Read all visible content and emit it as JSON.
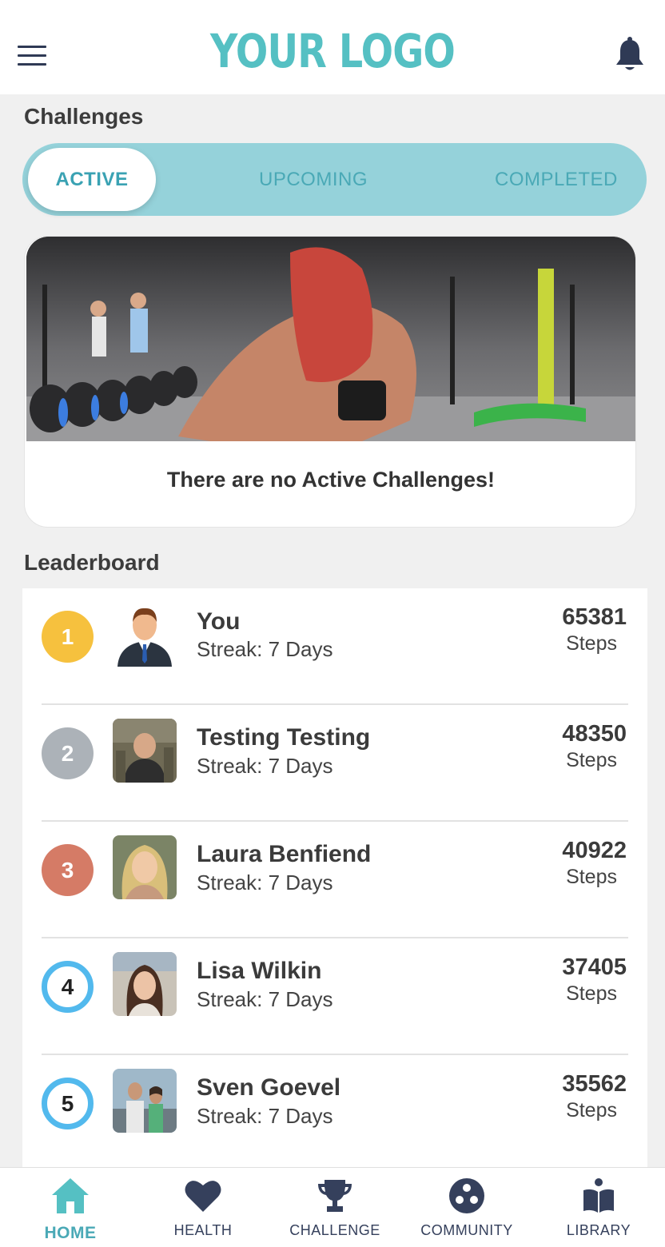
{
  "header": {
    "logo_text": "YOUR LOGO",
    "menu_icon": "hamburger-menu-icon",
    "notification_icon": "bell-icon"
  },
  "challenges": {
    "title": "Challenges",
    "tabs": [
      {
        "label": "ACTIVE",
        "selected": true
      },
      {
        "label": "UPCOMING",
        "selected": false
      },
      {
        "label": "COMPLETED",
        "selected": false
      }
    ],
    "empty_message": "There are no Active Challenges!"
  },
  "leaderboard": {
    "title": "Leaderboard",
    "entries": [
      {
        "rank": "1",
        "name": "You",
        "streak": "Streak: 7 Days",
        "steps": "65381",
        "unit": "Steps",
        "badge": "gold"
      },
      {
        "rank": "2",
        "name": "Testing Testing",
        "streak": "Streak: 7 Days",
        "steps": "48350",
        "unit": "Steps",
        "badge": "silver"
      },
      {
        "rank": "3",
        "name": "Laura Benfiend",
        "streak": "Streak: 7 Days",
        "steps": "40922",
        "unit": "Steps",
        "badge": "bronze"
      },
      {
        "rank": "4",
        "name": "Lisa Wilkin",
        "streak": "Streak: 7 Days",
        "steps": "37405",
        "unit": "Steps",
        "badge": "ring"
      },
      {
        "rank": "5",
        "name": "Sven Goevel",
        "streak": "Streak: 7 Days",
        "steps": "35562",
        "unit": "Steps",
        "badge": "ring"
      }
    ]
  },
  "bottom_nav": [
    {
      "label": "HOME",
      "icon": "home-icon",
      "active": true
    },
    {
      "label": "HEALTH",
      "icon": "heart-icon",
      "active": false
    },
    {
      "label": "CHALLENGE",
      "icon": "trophy-icon",
      "active": false
    },
    {
      "label": "COMMUNITY",
      "icon": "community-icon",
      "active": false
    },
    {
      "label": "LIBRARY",
      "icon": "library-icon",
      "active": false
    }
  ],
  "colors": {
    "accent": "#55c0c3",
    "tab_bar": "#95d2da",
    "nav_icon": "#35405c",
    "gold": "#f6c13e",
    "silver": "#acb2b8",
    "bronze": "#d57b66",
    "ring": "#52b9ed"
  }
}
